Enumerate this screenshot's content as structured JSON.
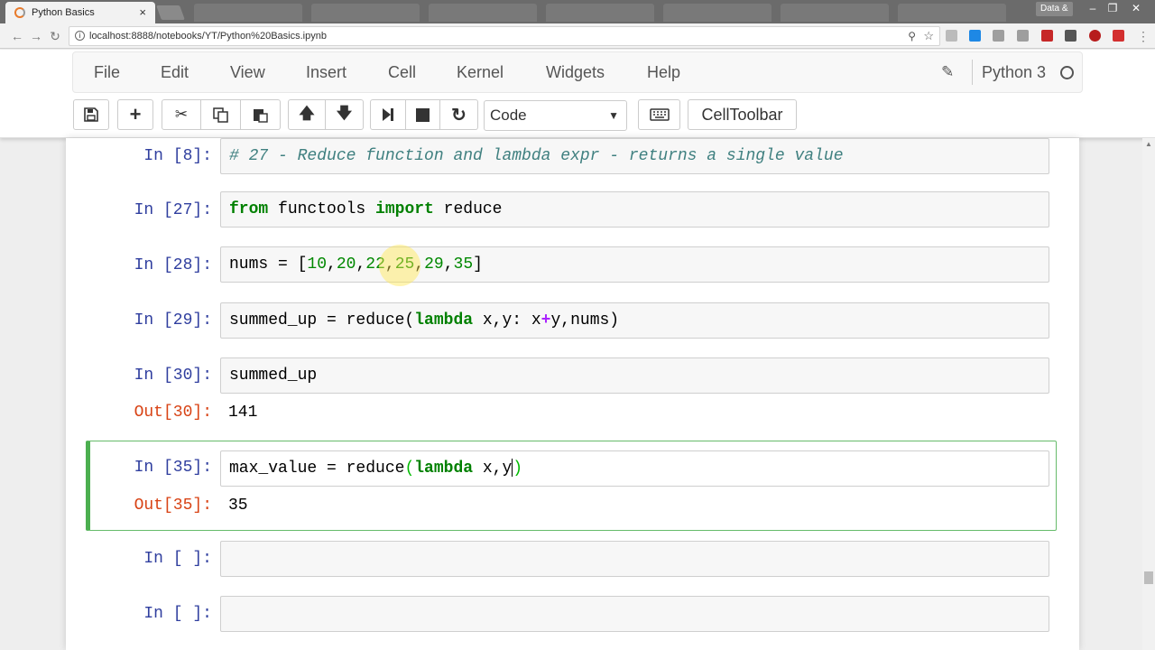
{
  "browser": {
    "tab_title": "Python Basics",
    "tab_close": "×",
    "profile_label": "Data &",
    "url": "localhost:8888/notebooks/YT/Python%20Basics.ipynb",
    "window_controls": [
      "–",
      "❐",
      "✕"
    ],
    "extension_colors": [
      "#bbbbbb",
      "#1e88e5",
      "#9e9e9e",
      "#9e9e9e",
      "#c62828",
      "#555555",
      "#b71c1c",
      "#d32f2f"
    ]
  },
  "menubar": {
    "items": [
      "File",
      "Edit",
      "View",
      "Insert",
      "Cell",
      "Kernel",
      "Widgets",
      "Help"
    ],
    "kernel_name": "Python 3"
  },
  "toolbar": {
    "cell_type": "Code",
    "celltoolbar_label": "CellToolbar",
    "icons": [
      "save-icon",
      "plus-icon",
      "cut-icon",
      "copy-icon",
      "paste-icon",
      "arrow-up-icon",
      "arrow-down-icon",
      "step-forward-icon",
      "stop-icon",
      "refresh-icon",
      "keyboard-icon"
    ]
  },
  "cells": [
    {
      "prompt": "In [8]:",
      "code_comment": "# 27 - Reduce function and lambda expr - returns a single value"
    },
    {
      "prompt": "In [27]:",
      "kw1": "from",
      "mid": " functools ",
      "kw2": "import",
      "rest": " reduce"
    },
    {
      "prompt": "In [28]:",
      "lhs": "nums = [",
      "numbers": [
        "10",
        "20",
        "22",
        "25",
        "29",
        "35"
      ],
      "close": "]"
    },
    {
      "prompt": "In [29]:",
      "pre": "summed_up = reduce(",
      "kw": "lambda",
      "mid": " x,y: x",
      "op": "+",
      "post": "y,nums)"
    },
    {
      "prompt": "In [30]:",
      "code": "summed_up",
      "out_prompt": "Out[30]:",
      "output": "141"
    },
    {
      "prompt": "In [35]:",
      "pre": "max_value = reduce",
      "paren": "(",
      "kw": "lambda",
      "mid": " x,y",
      "close_paren": ")",
      "out_prompt": "Out[35]:",
      "output": "35"
    },
    {
      "prompt": "In [ ]:"
    },
    {
      "prompt": "In [ ]:"
    }
  ],
  "colors": {
    "in_prompt": "#303f9f",
    "out_prompt": "#d84315",
    "keyword": "#008000",
    "selected_border": "#4caf50"
  }
}
